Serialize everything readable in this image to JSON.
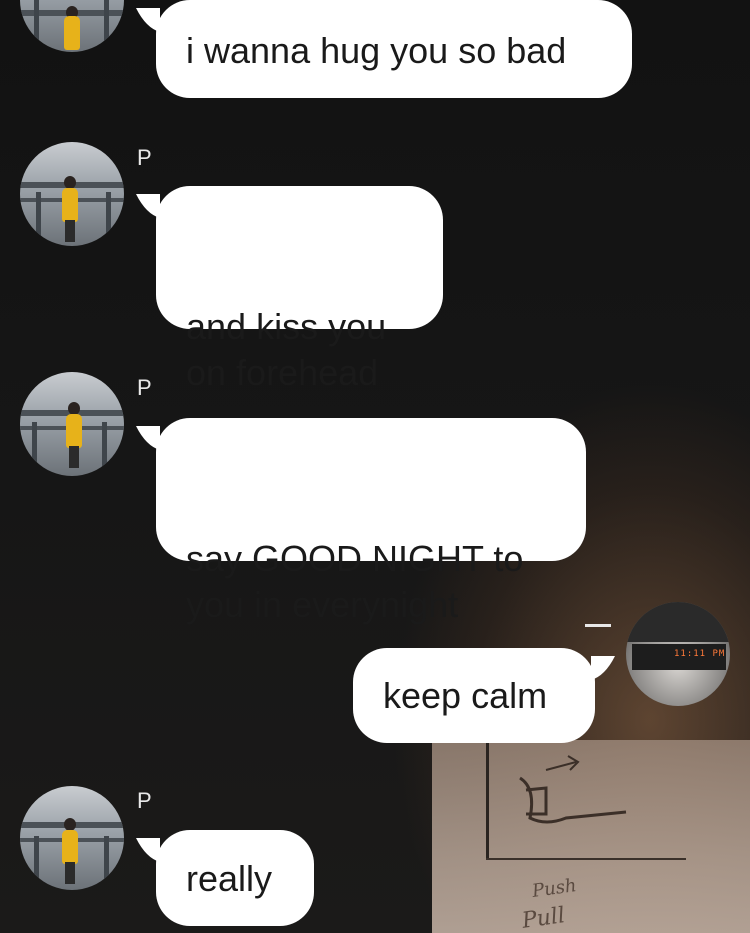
{
  "conversation": {
    "messages": [
      {
        "sender": "",
        "text": "i wanna hug you so bad",
        "from_me": false
      },
      {
        "sender": "P",
        "text": "and kiss you\non forehead",
        "from_me": false
      },
      {
        "sender": "P",
        "text": "say GOOD NIGHT to\nyou in everynight",
        "from_me": false
      },
      {
        "sender": "",
        "text": "keep calm",
        "from_me": true
      },
      {
        "sender": "P",
        "text": "really",
        "from_me": false
      }
    ],
    "my_status_mark": "—",
    "my_avatar_clock": "11:11 PM"
  },
  "background": {
    "sign_text_1": "Push",
    "sign_text_2": "Pull"
  },
  "colors": {
    "bubble": "#ffffff",
    "bubble_text": "#1a1a1a",
    "background": "#141414",
    "shirt": "#e7b21a"
  }
}
